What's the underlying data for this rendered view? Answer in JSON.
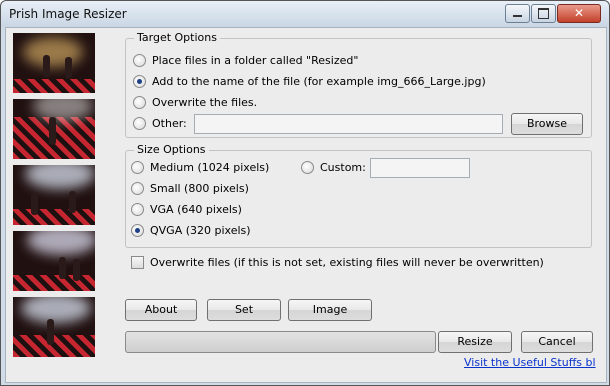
{
  "window": {
    "title": "Prish Image Resizer",
    "minimize_icon": "minimize-icon",
    "maximize_icon": "maximize-icon",
    "close_icon": "close-icon",
    "close_glyph": "✕"
  },
  "thumbnails": [
    {
      "alt": "concert-photo-1"
    },
    {
      "alt": "concert-photo-2"
    },
    {
      "alt": "concert-photo-3"
    },
    {
      "alt": "concert-photo-4"
    },
    {
      "alt": "concert-photo-5"
    }
  ],
  "target_options": {
    "label": "Target Options",
    "option_folder": "Place files in a folder called \"Resized\"",
    "option_add_name": "Add to the name of the file (for example img_666_Large.jpg)",
    "option_overwrite": "Overwrite the files.",
    "option_other": "Other:",
    "other_value": "",
    "selected": "add_name",
    "browse_label": "Browse"
  },
  "size_options": {
    "label": "Size Options",
    "medium": "Medium (1024 pixels)",
    "small": "Small (800 pixels)",
    "vga": "VGA (640 pixels)",
    "qvga": "QVGA (320 pixels)",
    "custom": "Custom:",
    "custom_value": "",
    "selected": "qvga"
  },
  "overwrite_checkbox": {
    "label": "Overwrite files (if this is not set, existing files will never be overwritten)",
    "checked": false
  },
  "buttons": {
    "about": "About",
    "set": "Set",
    "image": "Image",
    "resize": "Resize",
    "cancel": "Cancel"
  },
  "progress": {
    "value": 0
  },
  "footer_link": "Visit the Useful Stuffs bl",
  "colors": {
    "window_frame": "#cfdbe7",
    "client_bg": "#ececec",
    "link": "#0a33cc",
    "close_button": "#c2412a"
  }
}
